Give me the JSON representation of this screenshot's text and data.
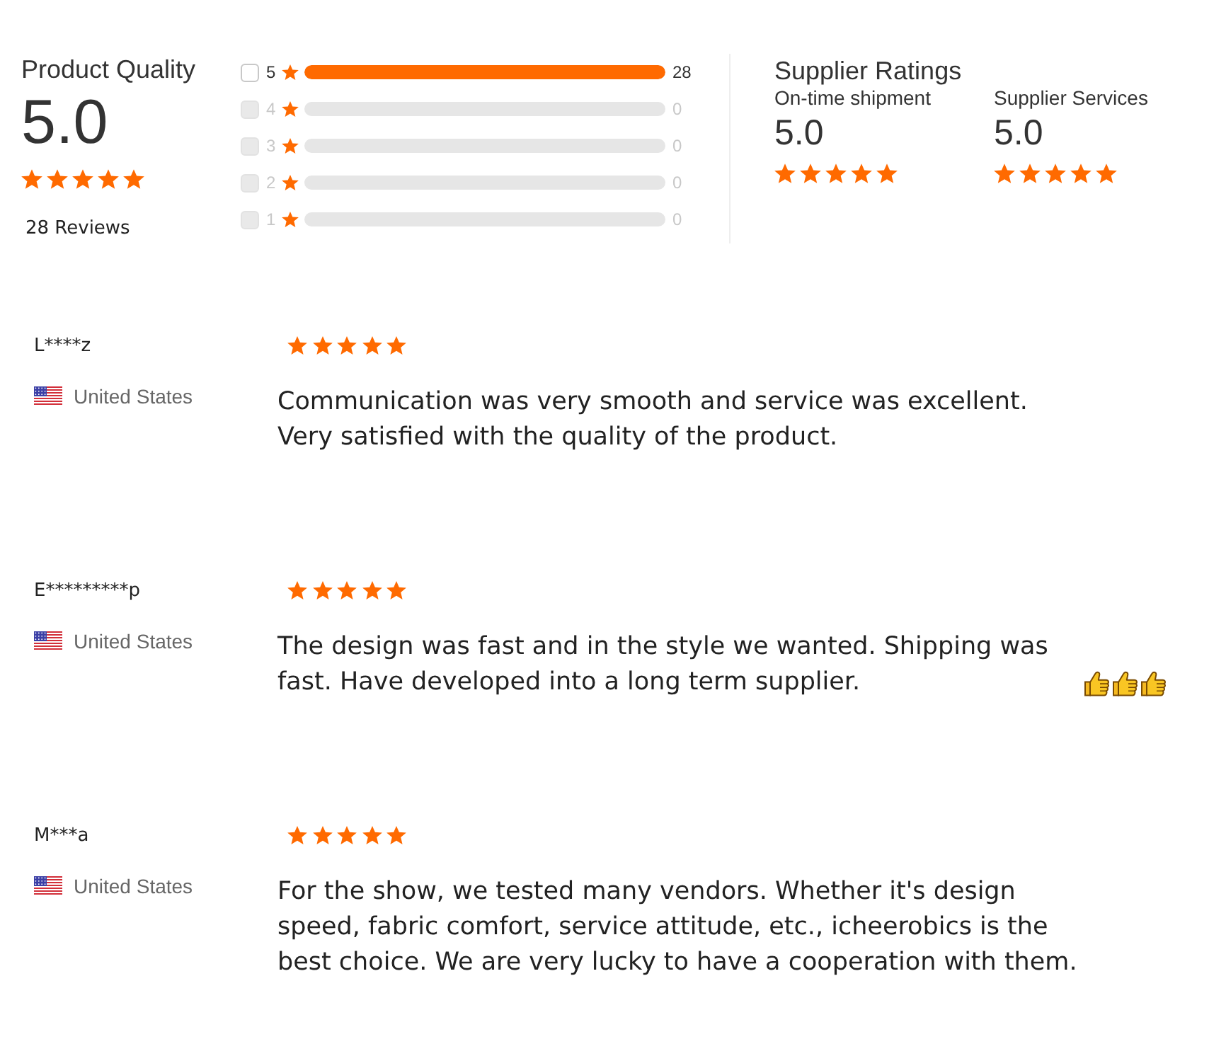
{
  "product_quality": {
    "title": "Product Quality",
    "score": "5.0",
    "stars": 5,
    "reviews_count": "28 Reviews"
  },
  "rating_breakdown": [
    {
      "label": "5",
      "count": "28",
      "level": 1,
      "checked": false,
      "disabled": false
    },
    {
      "label": "4",
      "count": "0",
      "checked": false,
      "disabled": true
    },
    {
      "label": "3",
      "count": "0",
      "checked": false,
      "disabled": true
    },
    {
      "label": "2",
      "count": "0",
      "checked": false,
      "disabled": true
    },
    {
      "label": "1",
      "count": "0",
      "checked": false,
      "disabled": true
    }
  ],
  "supplier_ratings": {
    "title": "Supplier Ratings",
    "metrics": [
      {
        "label": "On-time shipment",
        "score": "5.0",
        "stars": 5
      },
      {
        "label": "Supplier Services",
        "score": "5.0",
        "stars": 5
      }
    ]
  },
  "reviews": [
    {
      "reviewer": "L****z",
      "country": "United States",
      "stars": 5,
      "text": "Communication was very smooth and service was excellent. Very satisfied with the quality of the product."
    },
    {
      "reviewer": "E*********p",
      "country": "United States",
      "stars": 5,
      "text": "The design was fast and in the style we wanted. Shipping was fast. Have developed into a long term supplier.",
      "emoji": [
        {
          "kind": "thumbs-up"
        },
        {
          "kind": "thumbs-up"
        },
        {
          "kind": "thumbs-up"
        }
      ]
    },
    {
      "reviewer": "M***a",
      "country": "United States",
      "stars": 5,
      "text": "For the show, we tested many vendors. Whether it's design speed, fabric comfort, service attitude, etc., icheerobics is the best choice. We are very lucky to have a cooperation with them."
    }
  ]
}
